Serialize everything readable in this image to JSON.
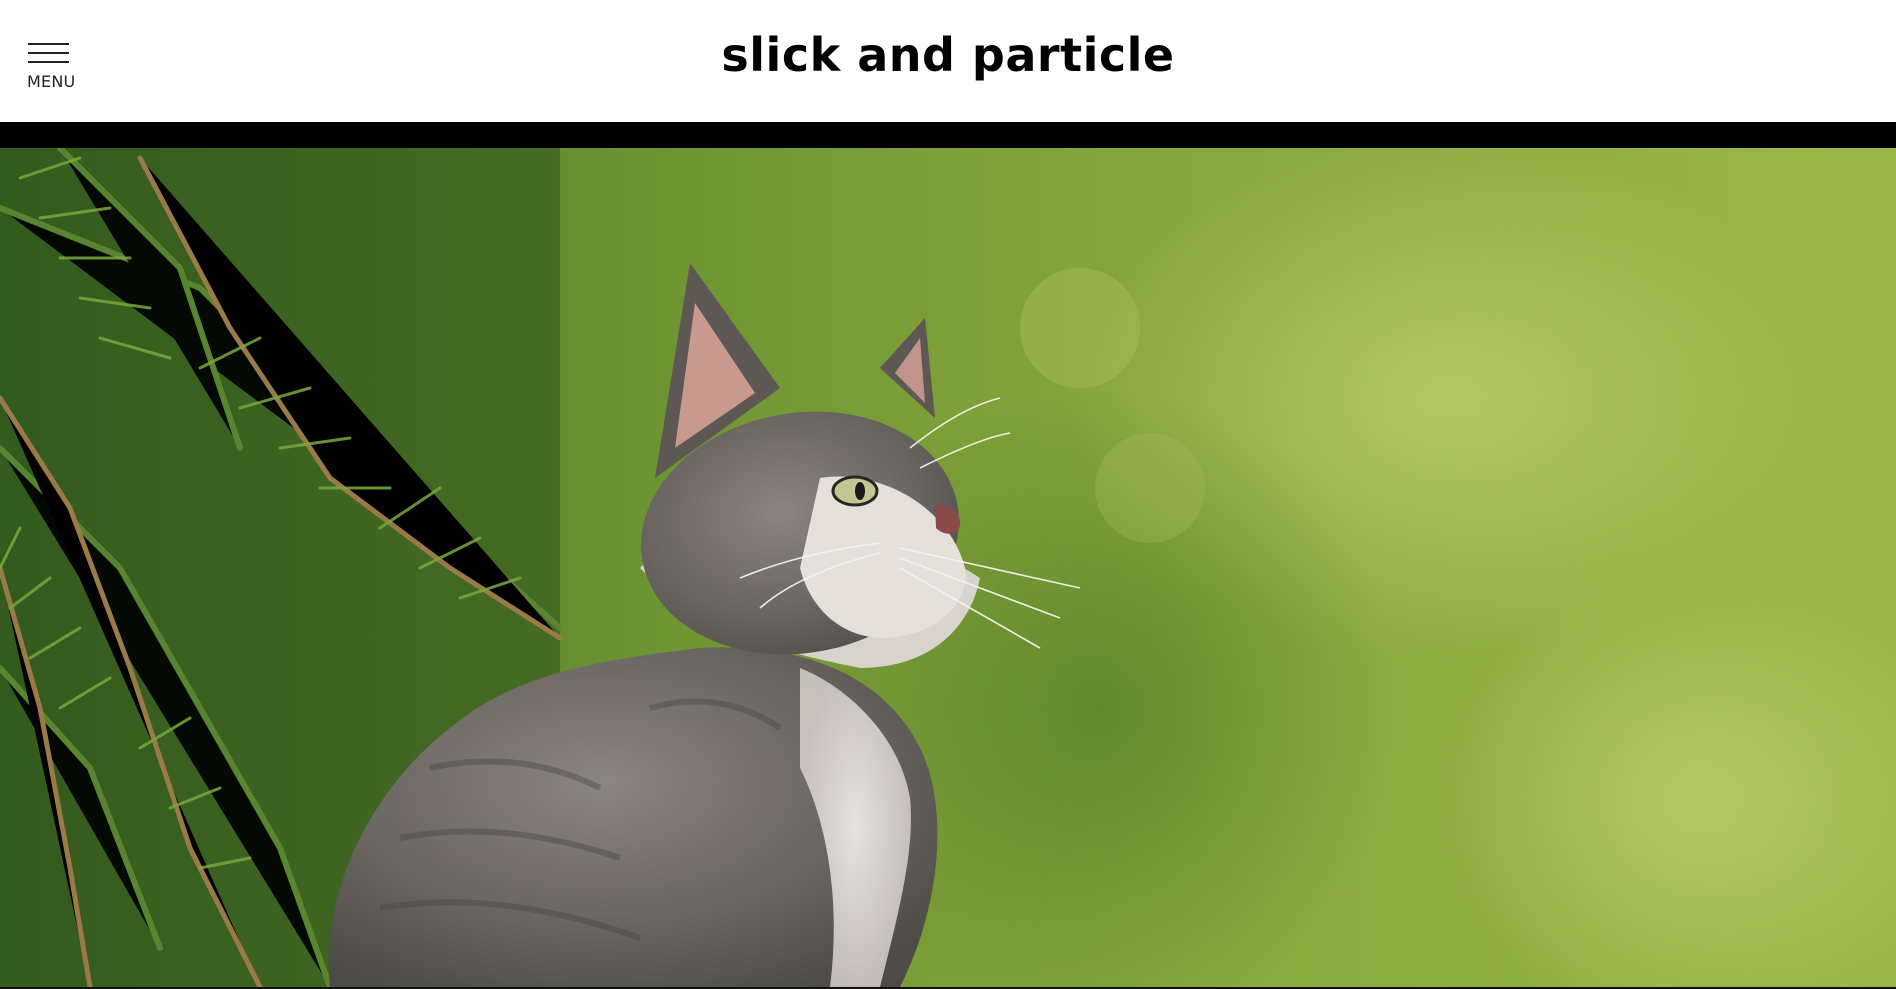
{
  "header": {
    "menu_label": "MENU",
    "site_title": "slick and particle"
  },
  "hero": {
    "icon": "kitten-photo",
    "colors": {
      "background_green": "#7fa23a",
      "foliage_dark": "#2f5a1f",
      "fur_gray": "#6f6a66",
      "fur_white": "#e9e6de"
    }
  }
}
